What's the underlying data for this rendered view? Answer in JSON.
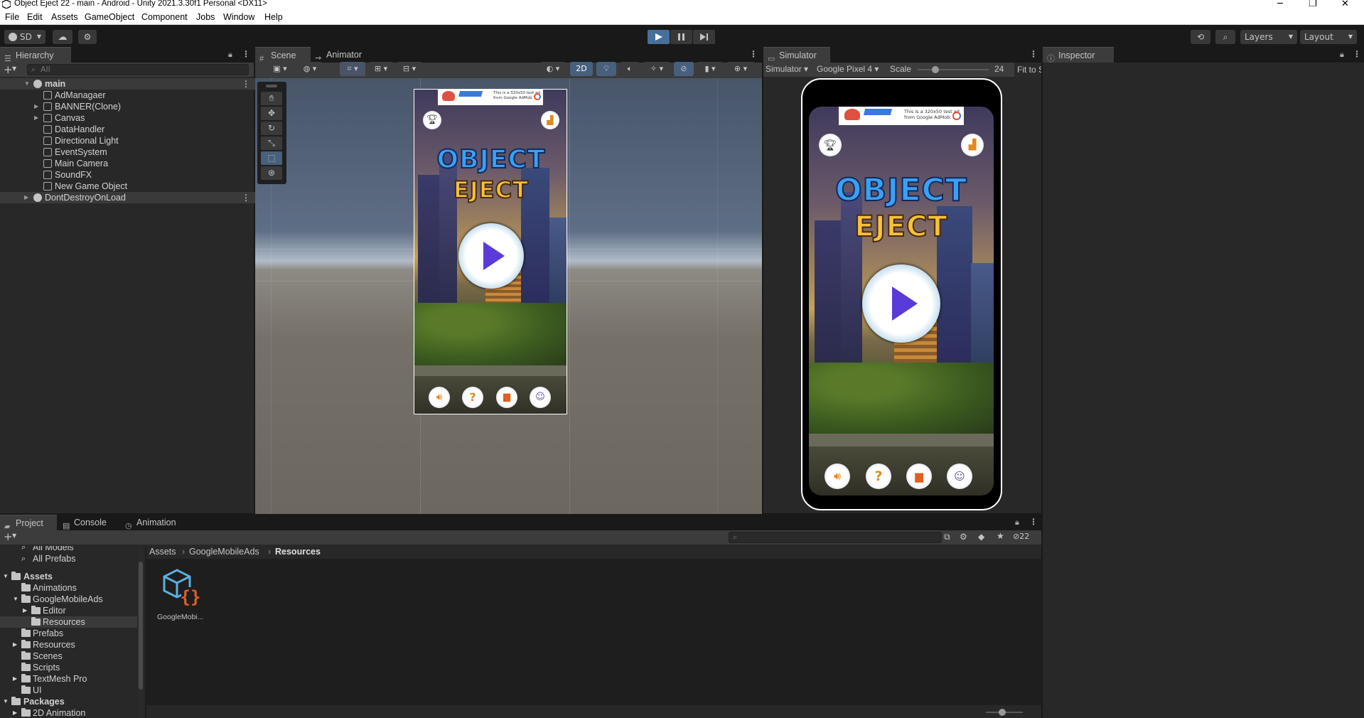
{
  "window": {
    "title": "Object Eject 22 - main - Android - Unity 2021.3.30f1 Personal <DX11>",
    "minimize": "─",
    "maximize": "❐",
    "close": "✕"
  },
  "menu": [
    "File",
    "Edit",
    "Assets",
    "GameObject",
    "Component",
    "Jobs",
    "Window",
    "Help"
  ],
  "toolbar": {
    "account": "SD",
    "layers": "Layers",
    "layout": "Layout"
  },
  "hierarchy": {
    "tab": "Hierarchy",
    "search_placeholder": "All",
    "root": "main",
    "items": [
      "AdManagaer",
      "BANNER(Clone)",
      "Canvas",
      "DataHandler",
      "Directional Light",
      "EventSystem",
      "Main Camera",
      "SoundFX",
      "New Game Object"
    ],
    "ddol": "DontDestroyOnLoad"
  },
  "scene": {
    "tabs": [
      "Scene",
      "Animator"
    ],
    "mode_2d": "2D"
  },
  "simulator": {
    "tab": "Simulator",
    "mode": "Simulator",
    "device": "Google Pixel 4",
    "scale_label": "Scale",
    "scale_value": "24",
    "fit": "Fit to S"
  },
  "inspector": {
    "tab": "Inspector"
  },
  "game": {
    "ad_line1": "This is a 320x50 test ad",
    "ad_line2": "from Google AdMob.",
    "logo_top": "OBJECT",
    "logo_bottom": "EJECT"
  },
  "bottom": {
    "tabs": [
      "Project",
      "Console",
      "Animation"
    ],
    "search_count": "22",
    "breadcrumb": [
      "Assets",
      "GoogleMobileAds",
      "Resources"
    ],
    "asset_label": "GoogleMobi...",
    "tree": [
      {
        "label": "All Models"
      },
      {
        "label": "All Prefabs"
      },
      {
        "label": "Assets"
      },
      {
        "label": "Animations"
      },
      {
        "label": "GoogleMobileAds"
      },
      {
        "label": "Editor"
      },
      {
        "label": "Resources"
      },
      {
        "label": "Prefabs"
      },
      {
        "label": "Resources"
      },
      {
        "label": "Scenes"
      },
      {
        "label": "Scripts"
      },
      {
        "label": "TextMesh Pro"
      },
      {
        "label": "UI"
      },
      {
        "label": "Packages"
      },
      {
        "label": "2D Animation"
      }
    ]
  }
}
